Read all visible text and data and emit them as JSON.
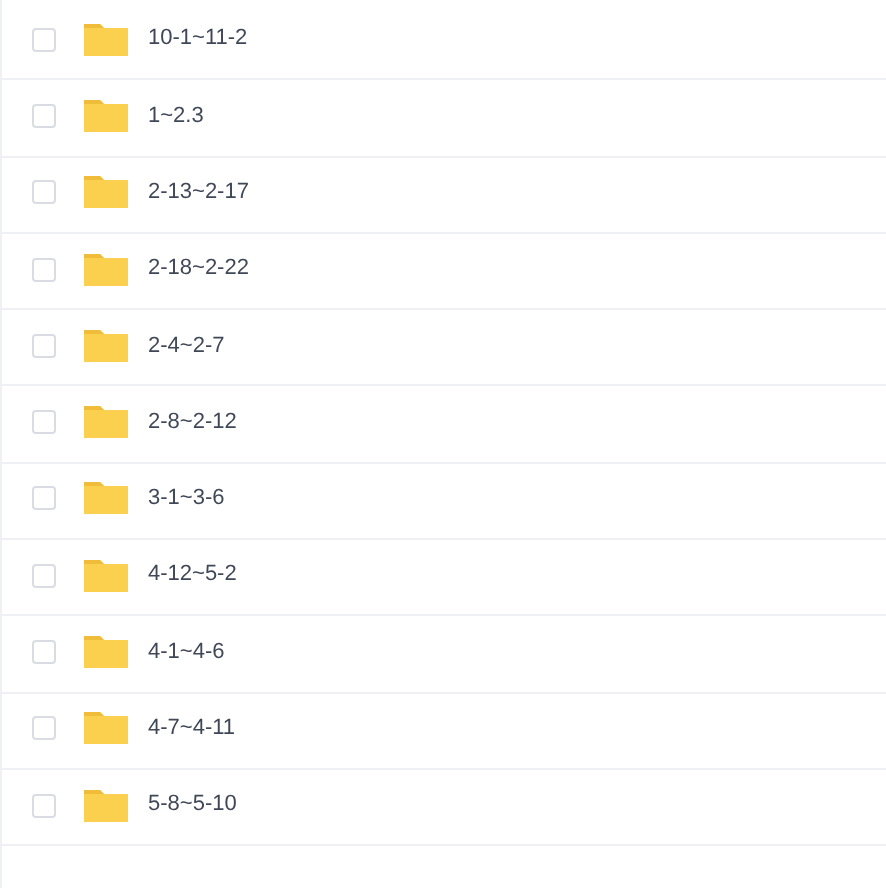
{
  "folders": [
    {
      "name": "10-1~11-2",
      "checked": false
    },
    {
      "name": "1~2.3",
      "checked": false
    },
    {
      "name": "2-13~2-17",
      "checked": false
    },
    {
      "name": "2-18~2-22",
      "checked": false
    },
    {
      "name": "2-4~2-7",
      "checked": false
    },
    {
      "name": "2-8~2-12",
      "checked": false
    },
    {
      "name": "3-1~3-6",
      "checked": false
    },
    {
      "name": "4-12~5-2",
      "checked": false
    },
    {
      "name": "4-1~4-6",
      "checked": false
    },
    {
      "name": "4-7~4-11",
      "checked": false
    },
    {
      "name": "5-8~5-10",
      "checked": false
    }
  ]
}
